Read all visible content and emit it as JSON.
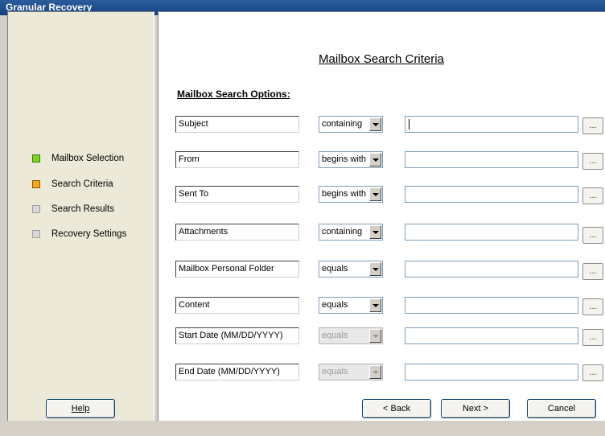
{
  "window": {
    "title": "Granular Recovery"
  },
  "steps": [
    {
      "label": "Mailbox Selection",
      "state": "green"
    },
    {
      "label": "Search Criteria",
      "state": "orange"
    },
    {
      "label": "Search Results",
      "state": "gray"
    },
    {
      "label": "Recovery Settings",
      "state": "gray"
    }
  ],
  "help_button": "Help",
  "page": {
    "title": "Mailbox Search Criteria",
    "subtitle": "Mailbox Search Options:"
  },
  "criteria": [
    {
      "field": "Subject",
      "operator": "containing",
      "value": "",
      "operator_enabled": true
    },
    {
      "field": "From",
      "operator": "begins with",
      "value": "",
      "operator_enabled": true
    },
    {
      "field": "Sent To",
      "operator": "begins with",
      "value": "",
      "operator_enabled": true
    },
    {
      "field": "Attachments",
      "operator": "containing",
      "value": "",
      "operator_enabled": true
    },
    {
      "field": "Mailbox Personal Folder",
      "operator": "equals",
      "value": "",
      "operator_enabled": true
    },
    {
      "field": "Content",
      "operator": "equals",
      "value": "",
      "operator_enabled": true
    },
    {
      "field": "Start Date  (MM/DD/YYYY)",
      "operator": "equals",
      "value": "",
      "operator_enabled": false
    },
    {
      "field": "End Date  (MM/DD/YYYY)",
      "operator": "equals",
      "value": "",
      "operator_enabled": false
    }
  ],
  "browse_label": "...",
  "buttons": {
    "back": "< Back",
    "next": "Next >",
    "cancel": "Cancel"
  },
  "colors": {
    "title_bar": "#1f4f8f",
    "step_done": "#7ed321",
    "step_current": "#f5a623",
    "step_pending": "#d8d8d8"
  }
}
